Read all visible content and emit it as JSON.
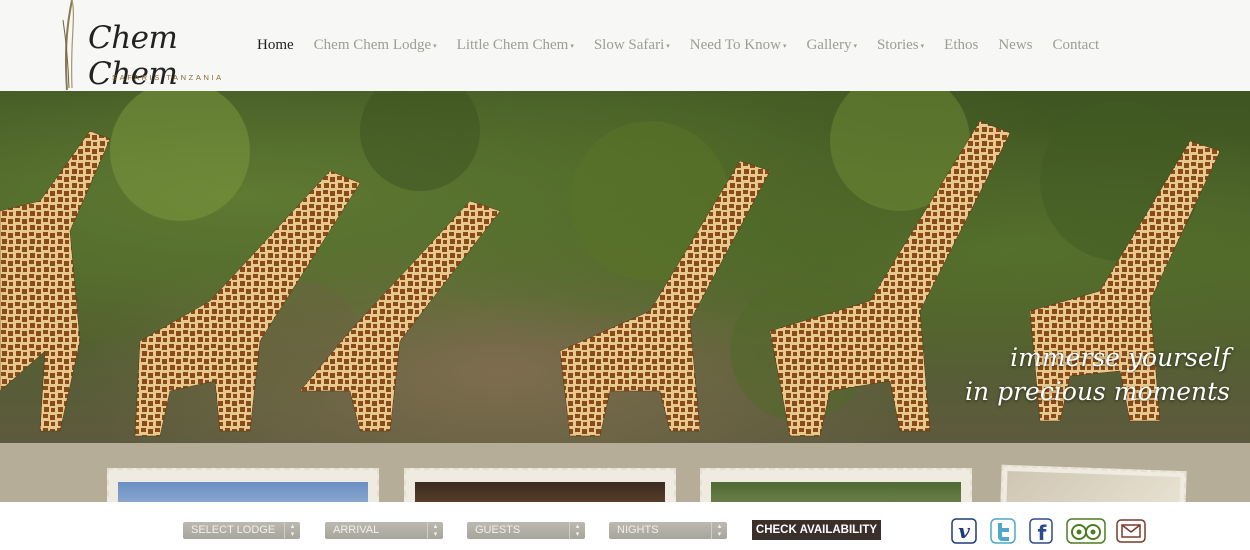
{
  "logo": {
    "script": "Chem Chem",
    "subtitle": "SAFARIS TANZANIA"
  },
  "nav": {
    "items": [
      {
        "label": "Home",
        "dropdown": false,
        "active": true
      },
      {
        "label": "Chem Chem Lodge",
        "dropdown": true,
        "active": false
      },
      {
        "label": "Little Chem Chem",
        "dropdown": true,
        "active": false
      },
      {
        "label": "Slow Safari",
        "dropdown": true,
        "active": false
      },
      {
        "label": "Need To Know",
        "dropdown": true,
        "active": false
      },
      {
        "label": "Gallery",
        "dropdown": true,
        "active": false
      },
      {
        "label": "Stories",
        "dropdown": true,
        "active": false
      },
      {
        "label": "Ethos",
        "dropdown": false,
        "active": false
      },
      {
        "label": "News",
        "dropdown": false,
        "active": false
      },
      {
        "label": "Contact",
        "dropdown": false,
        "active": false
      }
    ],
    "caret": "▾"
  },
  "hero": {
    "tagline_line1": "immerse yourself",
    "tagline_line2": "in precious moments"
  },
  "booking": {
    "lodge": "SELECT LODGE",
    "arrival": "ARRIVAL",
    "guests": "GUESTS",
    "nights": "NIGHTS",
    "select_arrow": "▴▾",
    "check": "CHECK AVAILABILITY"
  },
  "social": {
    "icons": [
      "vimeo-icon",
      "twitter-icon",
      "facebook-icon",
      "tripadvisor-icon",
      "email-icon"
    ],
    "vimeo_glyph": "v",
    "facebook_glyph": "f",
    "colors": {
      "vimeo": "#1a3c78",
      "twitter": "#4fa7c9",
      "facebook": "#2b4a8f",
      "tripadvisor": "#4d7d22",
      "email": "#7a3a2a"
    }
  },
  "colors": {
    "nav_text": "#9d9d95",
    "nav_active": "#1e1e1e",
    "band": "#b6ad99",
    "button": "#3a2f2a"
  }
}
